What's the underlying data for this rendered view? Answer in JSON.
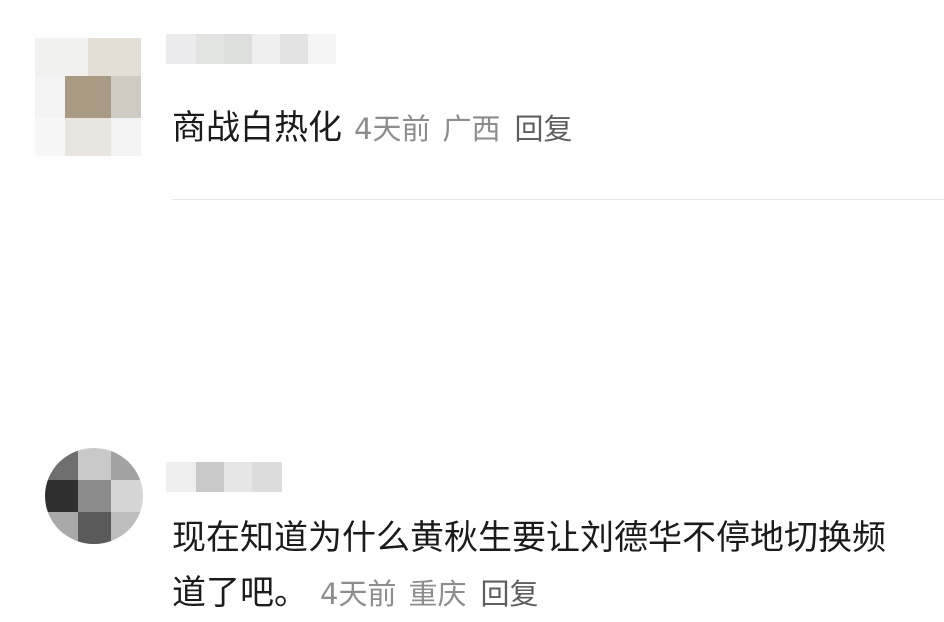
{
  "comments": [
    {
      "text": "商战白热化",
      "time": "4天前",
      "location": "广西",
      "reply": "回复"
    },
    {
      "text": "现在知道为什么黄秋生要让刘德华不停地切换频道了吧。",
      "time": "4天前",
      "location": "重庆",
      "reply": "回复"
    }
  ]
}
